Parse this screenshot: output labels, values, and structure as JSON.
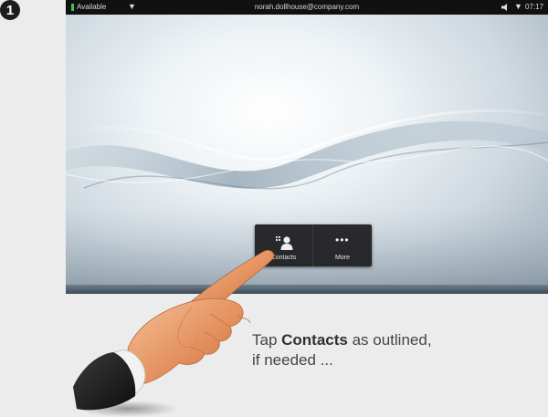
{
  "step": {
    "number": "1"
  },
  "statusbar": {
    "presence": "Available",
    "user": "norah.dollhouse@company.com",
    "time": "07:17",
    "icons": [
      "presence-caret-icon",
      "volume-icon",
      "volume-caret-icon"
    ]
  },
  "dock": {
    "buttons": [
      {
        "label": "Contacts",
        "icon": "contacts-icon"
      },
      {
        "label": "More",
        "icon": "more-icon"
      }
    ]
  },
  "instruction": {
    "prefix": "Tap ",
    "emphasis": "Contacts",
    "suffix": " as outlined,",
    "line2": "if needed ..."
  },
  "colors": {
    "status_bar": "#111111",
    "presence_green": "#41c44b",
    "dock_bg": "#1c1c1e",
    "text": "#454545"
  }
}
